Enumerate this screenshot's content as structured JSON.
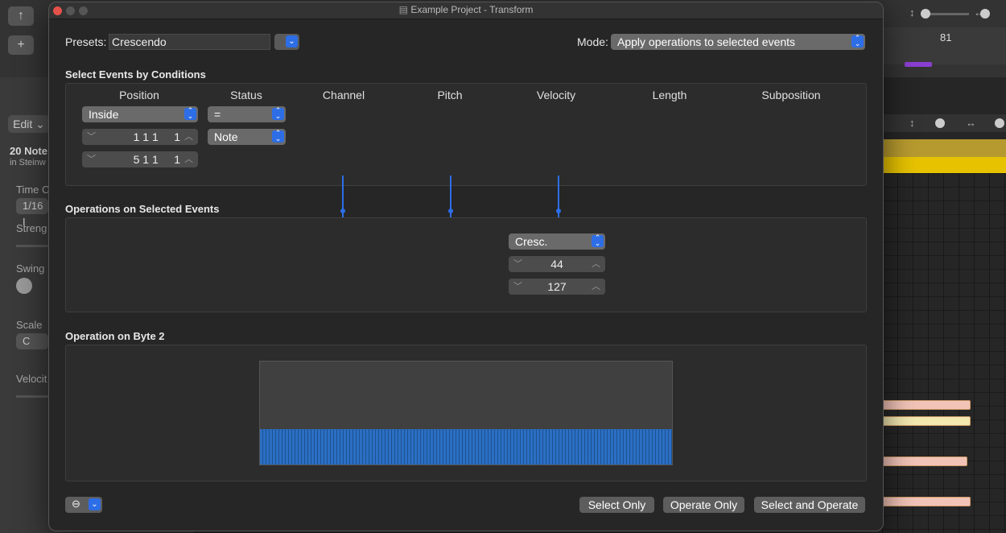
{
  "background": {
    "ruler_number": "81",
    "edit_label": "Edit",
    "notes_count": "20 Note",
    "instrument": "in Steinw",
    "time_label": "Time C",
    "time_value": "1/16 I",
    "strength_label": "Streng",
    "swing_label": "Swing",
    "scale_label": "Scale",
    "scale_value": "C",
    "velocity_label": "Velocit"
  },
  "window": {
    "title": "Example Project - Transform"
  },
  "presets": {
    "label": "Presets:",
    "value": "Crescendo"
  },
  "mode": {
    "label": "Mode:",
    "value": "Apply operations to selected events"
  },
  "conditions": {
    "title": "Select Events by Conditions",
    "columns": [
      "Position",
      "Status",
      "Channel",
      "Pitch",
      "Velocity",
      "Length",
      "Subposition"
    ],
    "position_condition": "Inside",
    "position_start": "1 1 1     1",
    "position_end": "5 1 1     1",
    "status_condition": "=",
    "status_value": "Note"
  },
  "operations": {
    "title": "Operations on Selected Events",
    "velocity_op": "Cresc.",
    "velocity_value1": "44",
    "velocity_value2": "127"
  },
  "byte2": {
    "title": "Operation on Byte 2"
  },
  "buttons": {
    "select_only": "Select Only",
    "operate_only": "Operate Only",
    "select_and_operate": "Select and Operate"
  }
}
